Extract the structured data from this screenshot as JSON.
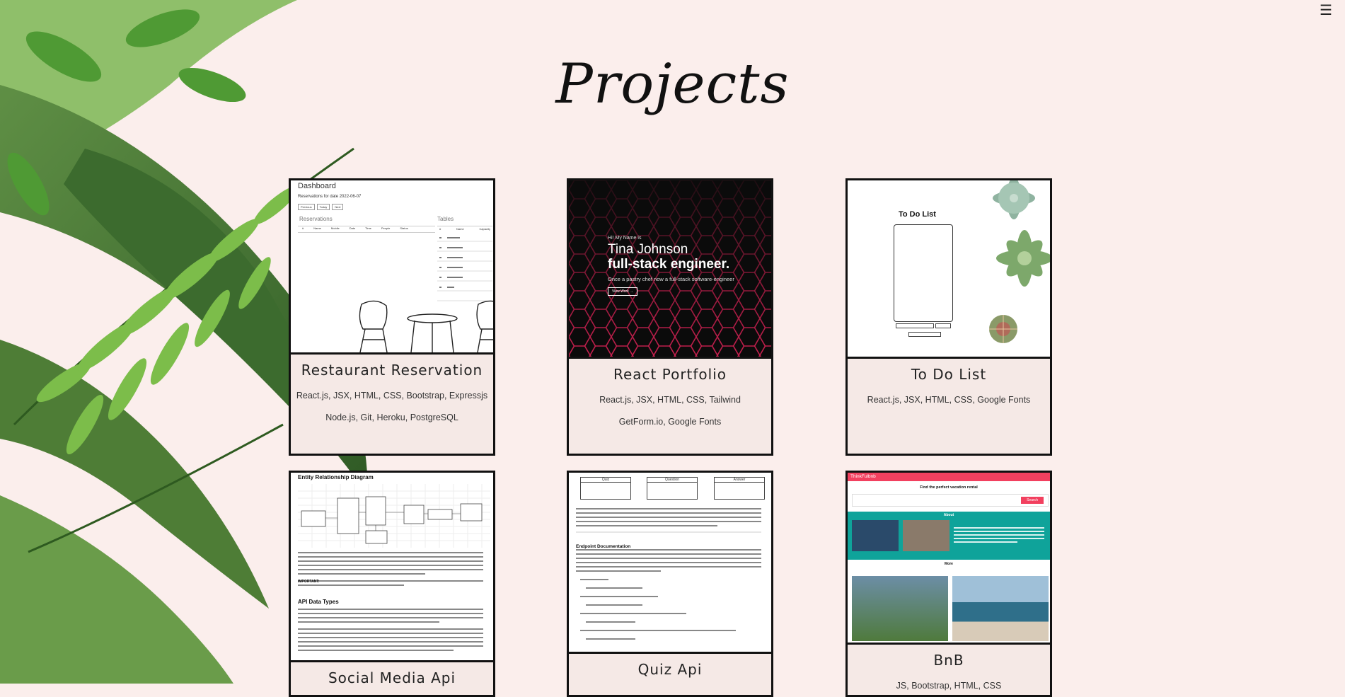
{
  "header": {
    "title": "Projects",
    "menu_icon": "hamburger-icon"
  },
  "projects": [
    {
      "title": "Restaurant Reservation",
      "tech": [
        "React.js, JSX, HTML, CSS, Bootstrap, Expressjs",
        "Node.js, Git, Heroku, PostgreSQL"
      ],
      "preview": {
        "heading": "Dashboard",
        "subheading": "Reservations for date 2022-06-07",
        "buttons": [
          "Previous",
          "Today",
          "Next"
        ],
        "left_label": "Reservations",
        "right_label": "Tables",
        "columns": [
          "#",
          "Name",
          "Mobile",
          "Date",
          "Time",
          "People",
          "Status"
        ],
        "table_columns": [
          "#",
          "Name",
          "Capacity"
        ]
      }
    },
    {
      "title": "React Portfolio",
      "tech": [
        "React.js, JSX, HTML, CSS, Tailwind",
        "GetForm.io, Google Fonts"
      ],
      "preview": {
        "greeting": "Hi! My Name is",
        "name": "Tina Johnson",
        "role": "full-stack engineer.",
        "tagline": "Once a pastry chef now a full-stack software-engineer",
        "cta": "View Work →"
      }
    },
    {
      "title": "To Do List",
      "tech": [
        "React.js, JSX, HTML, CSS, Google Fonts"
      ],
      "preview": {
        "heading": "To Do List"
      }
    },
    {
      "title": "Social Media Api",
      "tech": [],
      "preview": {
        "heading": "Entity Relationship Diagram",
        "section": "API Data Types",
        "important": "IMPORTANT:"
      }
    },
    {
      "title": "Quiz Api",
      "tech": [],
      "preview": {
        "boxes": [
          "Quiz",
          "Question",
          "Answer"
        ],
        "section": "Endpoint Documentation"
      }
    },
    {
      "title": "BnB",
      "tech": [
        "JS, Bootstrap, HTML, CSS"
      ],
      "preview": {
        "brand": "ThinkFulbnb",
        "hero": "Find the perfect vacation rental",
        "search_button": "Search",
        "about": "About",
        "more": "More"
      }
    }
  ],
  "colors": {
    "background": "#fbeeec",
    "card": "#f5e9e6",
    "portfolio_accent": "#e0245e",
    "bnb_red": "#f2405f",
    "bnb_teal": "#0fa39a"
  }
}
